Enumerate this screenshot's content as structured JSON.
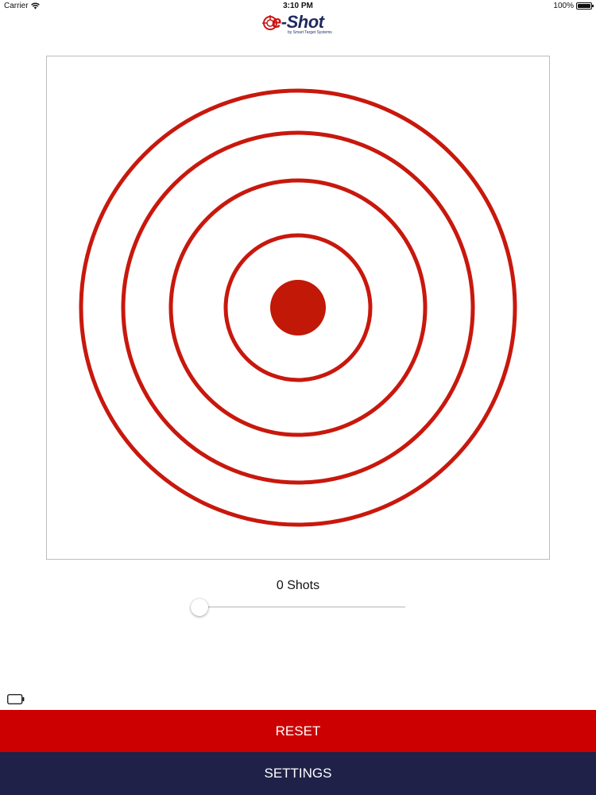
{
  "status_bar": {
    "carrier": "Carrier",
    "wifi_icon": "wifi-icon",
    "time": "3:10 PM",
    "battery_percent": "100%",
    "battery_icon": "battery-icon"
  },
  "header": {
    "logo_text_e": "e",
    "logo_text_rest": "-Shot",
    "logo_tagline": "by Smart Target Systems"
  },
  "target": {
    "ring_count": 4,
    "has_bullseye": true,
    "ring_color": "#c8180d",
    "bullseye_color": "#c21807"
  },
  "shots": {
    "label": "0 Shots",
    "count": 0
  },
  "slider": {
    "value": 0,
    "min": 0,
    "max": 1
  },
  "device_battery": {
    "icon": "battery-outline-icon"
  },
  "buttons": {
    "reset_label": "RESET",
    "settings_label": "SETTINGS"
  },
  "colors": {
    "reset_bg": "#cc0000",
    "settings_bg": "#1f2148",
    "brand_navy": "#1e2a5e",
    "brand_red": "#cc1313"
  }
}
